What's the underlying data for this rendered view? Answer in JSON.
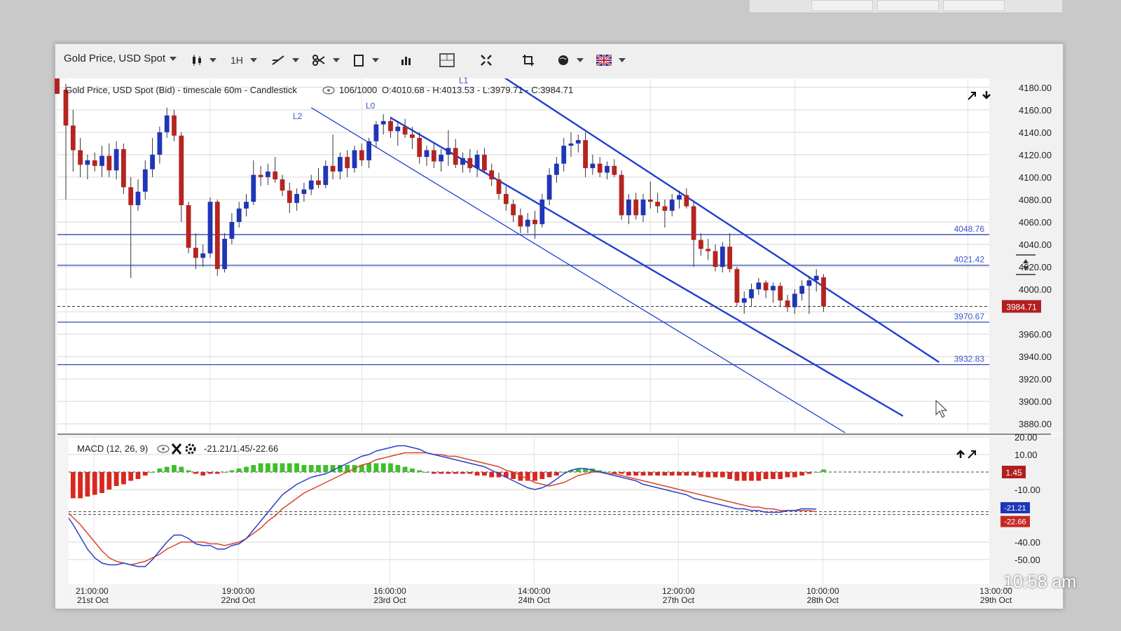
{
  "toolbar": {
    "instrument": "Gold Price, USD Spot",
    "timeframe": "1H"
  },
  "main_chart": {
    "header": "Gold Price, USD Spot (Bid) - timescale 60m - Candlestick",
    "counter": "106/1000",
    "ohlc": "O:4010.68 - H:4013.53 - L:3979.71 - C:3984.71",
    "channel_labels": [
      "L2",
      "L0",
      "L1"
    ],
    "last_price_label": "3984.71"
  },
  "macd": {
    "title": "MACD (12, 26, 9)",
    "values": "-21.21/1.45/-22.66",
    "hist_label": "1.45",
    "macd_label": "-21.21",
    "signal_label": "-22.66"
  },
  "chart_data": [
    {
      "type": "candlestick",
      "title": "Gold Price, USD Spot (Bid) - timescale 60m - Candlestick",
      "y_ticks": [
        4180,
        4160,
        4140,
        4120,
        4100,
        4080,
        4060,
        4040,
        4020,
        4000,
        3980,
        3960,
        3940,
        3920,
        3900,
        3880
      ],
      "y_tick_labels": [
        "4180.00",
        "4160.00",
        "4140.00",
        "4120.00",
        "4100.00",
        "4080.00",
        "4060.00",
        "4040.00",
        "4020.00",
        "4000.00",
        "",
        "3960.00",
        "3940.00",
        "3920.00",
        "3900.00",
        "3880.00"
      ],
      "ylim": [
        3872,
        4188
      ],
      "x_ticks": [
        {
          "idx": 0,
          "time": "21:00:00",
          "date": "21st Oct"
        },
        {
          "idx": 20,
          "time": "19:00:00",
          "date": "22nd Oct"
        },
        {
          "idx": 41,
          "time": "16:00:00",
          "date": "23rd Oct"
        },
        {
          "idx": 61,
          "time": "14:00:00",
          "date": "24th Oct"
        },
        {
          "idx": 81,
          "time": "12:00:00",
          "date": "27th Oct"
        },
        {
          "idx": 101,
          "time": "10:00:00",
          "date": "28th Oct"
        },
        {
          "idx": 125,
          "time": "13:00:00",
          "date": "29th Oct"
        }
      ],
      "horizontal_levels": [
        {
          "value": 4048.76,
          "label": "4048.76"
        },
        {
          "value": 4021.42,
          "label": "4021.42"
        },
        {
          "value": 3970.67,
          "label": "3970.67"
        },
        {
          "value": 3932.83,
          "label": "3932.83"
        }
      ],
      "last_price": 3984.71,
      "channel_lines": [
        {
          "name": "L1",
          "from": [
            60,
            4192
          ],
          "to": [
            121,
            3935
          ]
        },
        {
          "name": "L0",
          "from": [
            45,
            4153
          ],
          "to": [
            116,
            3887
          ]
        },
        {
          "name": "L2",
          "from": [
            34,
            4162
          ],
          "to": [
            108,
            3872
          ]
        }
      ],
      "candles": [
        {
          "o": 4178,
          "h": 4183,
          "l": 4080,
          "c": 4146
        },
        {
          "o": 4146,
          "h": 4160,
          "l": 4105,
          "c": 4124
        },
        {
          "o": 4124,
          "h": 4135,
          "l": 4100,
          "c": 4111
        },
        {
          "o": 4111,
          "h": 4120,
          "l": 4098,
          "c": 4115
        },
        {
          "o": 4115,
          "h": 4122,
          "l": 4105,
          "c": 4110
        },
        {
          "o": 4110,
          "h": 4128,
          "l": 4100,
          "c": 4119
        },
        {
          "o": 4119,
          "h": 4130,
          "l": 4100,
          "c": 4106
        },
        {
          "o": 4106,
          "h": 4132,
          "l": 4098,
          "c": 4125
        },
        {
          "o": 4125,
          "h": 4130,
          "l": 4085,
          "c": 4091
        },
        {
          "o": 4091,
          "h": 4100,
          "l": 4010,
          "c": 4075
        },
        {
          "o": 4075,
          "h": 4098,
          "l": 4070,
          "c": 4087
        },
        {
          "o": 4087,
          "h": 4115,
          "l": 4080,
          "c": 4107
        },
        {
          "o": 4107,
          "h": 4135,
          "l": 4100,
          "c": 4120
        },
        {
          "o": 4120,
          "h": 4145,
          "l": 4112,
          "c": 4140
        },
        {
          "o": 4140,
          "h": 4162,
          "l": 4135,
          "c": 4155
        },
        {
          "o": 4155,
          "h": 4160,
          "l": 4132,
          "c": 4137
        },
        {
          "o": 4137,
          "h": 4140,
          "l": 4060,
          "c": 4075
        },
        {
          "o": 4075,
          "h": 4078,
          "l": 4032,
          "c": 4037
        },
        {
          "o": 4037,
          "h": 4050,
          "l": 4018,
          "c": 4028
        },
        {
          "o": 4028,
          "h": 4040,
          "l": 4020,
          "c": 4032
        },
        {
          "o": 4032,
          "h": 4082,
          "l": 4028,
          "c": 4078
        },
        {
          "o": 4078,
          "h": 4080,
          "l": 4012,
          "c": 4018
        },
        {
          "o": 4018,
          "h": 4050,
          "l": 4015,
          "c": 4045
        },
        {
          "o": 4045,
          "h": 4068,
          "l": 4040,
          "c": 4060
        },
        {
          "o": 4060,
          "h": 4078,
          "l": 4055,
          "c": 4072
        },
        {
          "o": 4072,
          "h": 4085,
          "l": 4065,
          "c": 4078
        },
        {
          "o": 4078,
          "h": 4115,
          "l": 4075,
          "c": 4102
        },
        {
          "o": 4102,
          "h": 4110,
          "l": 4092,
          "c": 4100
        },
        {
          "o": 4100,
          "h": 4112,
          "l": 4093,
          "c": 4105
        },
        {
          "o": 4105,
          "h": 4118,
          "l": 4095,
          "c": 4098
        },
        {
          "o": 4098,
          "h": 4102,
          "l": 4083,
          "c": 4088
        },
        {
          "o": 4088,
          "h": 4095,
          "l": 4068,
          "c": 4077
        },
        {
          "o": 4077,
          "h": 4090,
          "l": 4070,
          "c": 4085
        },
        {
          "o": 4085,
          "h": 4095,
          "l": 4078,
          "c": 4089
        },
        {
          "o": 4089,
          "h": 4102,
          "l": 4084,
          "c": 4097
        },
        {
          "o": 4097,
          "h": 4108,
          "l": 4090,
          "c": 4093
        },
        {
          "o": 4093,
          "h": 4115,
          "l": 4090,
          "c": 4110
        },
        {
          "o": 4110,
          "h": 4138,
          "l": 4098,
          "c": 4105
        },
        {
          "o": 4105,
          "h": 4122,
          "l": 4098,
          "c": 4118
        },
        {
          "o": 4118,
          "h": 4124,
          "l": 4100,
          "c": 4108
        },
        {
          "o": 4108,
          "h": 4128,
          "l": 4104,
          "c": 4124
        },
        {
          "o": 4124,
          "h": 4130,
          "l": 4110,
          "c": 4115
        },
        {
          "o": 4115,
          "h": 4135,
          "l": 4108,
          "c": 4132
        },
        {
          "o": 4132,
          "h": 4150,
          "l": 4126,
          "c": 4147
        },
        {
          "o": 4147,
          "h": 4156,
          "l": 4138,
          "c": 4150
        },
        {
          "o": 4150,
          "h": 4154,
          "l": 4135,
          "c": 4141
        },
        {
          "o": 4141,
          "h": 4150,
          "l": 4128,
          "c": 4145
        },
        {
          "o": 4145,
          "h": 4152,
          "l": 4135,
          "c": 4138
        },
        {
          "o": 4138,
          "h": 4145,
          "l": 4125,
          "c": 4135
        },
        {
          "o": 4135,
          "h": 4140,
          "l": 4112,
          "c": 4118
        },
        {
          "o": 4118,
          "h": 4128,
          "l": 4110,
          "c": 4124
        },
        {
          "o": 4124,
          "h": 4130,
          "l": 4108,
          "c": 4114
        },
        {
          "o": 4114,
          "h": 4125,
          "l": 4105,
          "c": 4120
        },
        {
          "o": 4120,
          "h": 4142,
          "l": 4110,
          "c": 4126
        },
        {
          "o": 4126,
          "h": 4134,
          "l": 4108,
          "c": 4111
        },
        {
          "o": 4111,
          "h": 4122,
          "l": 4104,
          "c": 4117
        },
        {
          "o": 4117,
          "h": 4125,
          "l": 4104,
          "c": 4108
        },
        {
          "o": 4108,
          "h": 4124,
          "l": 4100,
          "c": 4120
        },
        {
          "o": 4120,
          "h": 4126,
          "l": 4104,
          "c": 4106
        },
        {
          "o": 4106,
          "h": 4112,
          "l": 4092,
          "c": 4098
        },
        {
          "o": 4098,
          "h": 4104,
          "l": 4080,
          "c": 4085
        },
        {
          "o": 4085,
          "h": 4092,
          "l": 4070,
          "c": 4076
        },
        {
          "o": 4076,
          "h": 4080,
          "l": 4060,
          "c": 4066
        },
        {
          "o": 4066,
          "h": 4072,
          "l": 4050,
          "c": 4056
        },
        {
          "o": 4056,
          "h": 4068,
          "l": 4050,
          "c": 4062
        },
        {
          "o": 4062,
          "h": 4070,
          "l": 4045,
          "c": 4058
        },
        {
          "o": 4058,
          "h": 4085,
          "l": 4055,
          "c": 4080
        },
        {
          "o": 4080,
          "h": 4108,
          "l": 4075,
          "c": 4102
        },
        {
          "o": 4102,
          "h": 4118,
          "l": 4095,
          "c": 4112
        },
        {
          "o": 4112,
          "h": 4135,
          "l": 4105,
          "c": 4128
        },
        {
          "o": 4128,
          "h": 4140,
          "l": 4118,
          "c": 4130
        },
        {
          "o": 4130,
          "h": 4138,
          "l": 4122,
          "c": 4133
        },
        {
          "o": 4133,
          "h": 4140,
          "l": 4100,
          "c": 4108
        },
        {
          "o": 4108,
          "h": 4120,
          "l": 4102,
          "c": 4112
        },
        {
          "o": 4112,
          "h": 4118,
          "l": 4100,
          "c": 4104
        },
        {
          "o": 4104,
          "h": 4114,
          "l": 4098,
          "c": 4110
        },
        {
          "o": 4110,
          "h": 4116,
          "l": 4100,
          "c": 4102
        },
        {
          "o": 4102,
          "h": 4106,
          "l": 4062,
          "c": 4066
        },
        {
          "o": 4066,
          "h": 4085,
          "l": 4058,
          "c": 4080
        },
        {
          "o": 4080,
          "h": 4086,
          "l": 4062,
          "c": 4066
        },
        {
          "o": 4066,
          "h": 4085,
          "l": 4060,
          "c": 4080
        },
        {
          "o": 4080,
          "h": 4096,
          "l": 4072,
          "c": 4078
        },
        {
          "o": 4078,
          "h": 4086,
          "l": 4068,
          "c": 4074
        },
        {
          "o": 4074,
          "h": 4080,
          "l": 4055,
          "c": 4070
        },
        {
          "o": 4070,
          "h": 4085,
          "l": 4065,
          "c": 4080
        },
        {
          "o": 4080,
          "h": 4088,
          "l": 4072,
          "c": 4084
        },
        {
          "o": 4084,
          "h": 4090,
          "l": 4072,
          "c": 4074
        },
        {
          "o": 4074,
          "h": 4078,
          "l": 4020,
          "c": 4044
        },
        {
          "o": 4044,
          "h": 4050,
          "l": 4030,
          "c": 4036
        },
        {
          "o": 4036,
          "h": 4045,
          "l": 4026,
          "c": 4034
        },
        {
          "o": 4034,
          "h": 4040,
          "l": 4016,
          "c": 4020
        },
        {
          "o": 4020,
          "h": 4042,
          "l": 4015,
          "c": 4038
        },
        {
          "o": 4038,
          "h": 4050,
          "l": 4015,
          "c": 4018
        },
        {
          "o": 4018,
          "h": 4020,
          "l": 3985,
          "c": 3988
        },
        {
          "o": 3988,
          "h": 3998,
          "l": 3978,
          "c": 3992
        },
        {
          "o": 3992,
          "h": 4005,
          "l": 3985,
          "c": 4000
        },
        {
          "o": 4000,
          "h": 4010,
          "l": 3995,
          "c": 4006
        },
        {
          "o": 4006,
          "h": 4008,
          "l": 3992,
          "c": 3999
        },
        {
          "o": 3999,
          "h": 4006,
          "l": 3988,
          "c": 4003
        },
        {
          "o": 4003,
          "h": 4006,
          "l": 3985,
          "c": 3990
        },
        {
          "o": 3990,
          "h": 3995,
          "l": 3980,
          "c": 3984
        },
        {
          "o": 3984,
          "h": 4000,
          "l": 3978,
          "c": 3996
        },
        {
          "o": 3996,
          "h": 4008,
          "l": 3990,
          "c": 4003
        },
        {
          "o": 4003,
          "h": 4012,
          "l": 3978,
          "c": 4008
        },
        {
          "o": 4008,
          "h": 4018,
          "l": 3998,
          "c": 4012
        },
        {
          "o": 4010.68,
          "h": 4013.53,
          "l": 3979.71,
          "c": 3984.71
        }
      ]
    },
    {
      "type": "macd",
      "title": "MACD (12, 26, 9)",
      "y_ticks": [
        20,
        10,
        -10,
        -40,
        -50
      ],
      "y_tick_labels": [
        "20.00",
        "10.00",
        "-10.00",
        "-40.00",
        "-50.00"
      ],
      "ylim": [
        -64,
        20
      ],
      "x_ticks_same_as_price": true,
      "reference_level": -22.66,
      "histogram": [
        -16,
        -15,
        -15,
        -14,
        -13,
        -12,
        -10,
        -8,
        -7,
        -5,
        -4,
        -2,
        0,
        2,
        3,
        4,
        3,
        1,
        -1,
        -2,
        -1,
        -1,
        0,
        1,
        2,
        3,
        4,
        5,
        5,
        5,
        5,
        5,
        5,
        4,
        4,
        4,
        4,
        4,
        4,
        4,
        4,
        4,
        5,
        5,
        5,
        5,
        4,
        3,
        2,
        1,
        0,
        -1,
        -1,
        -1,
        -1,
        -1,
        -1,
        -2,
        -2,
        -3,
        -3,
        -3,
        -4,
        -5,
        -5,
        -5,
        -4,
        -3,
        -2,
        0,
        1,
        2,
        2,
        2,
        1,
        0,
        -1,
        -1,
        -2,
        -2,
        -2,
        -2,
        -2,
        -2,
        -2,
        -2,
        -2,
        -2,
        -3,
        -3,
        -3,
        -3,
        -4,
        -5,
        -5,
        -5,
        -5,
        -4,
        -4,
        -4,
        -3,
        -3,
        -2,
        -1,
        0,
        1.45
      ],
      "macd_line": [
        -24,
        -30,
        -37,
        -44,
        -49,
        -52,
        -53,
        -53,
        -52,
        -53,
        -54,
        -54,
        -50,
        -45,
        -40,
        -36,
        -36,
        -38,
        -41,
        -42,
        -42,
        -44,
        -44,
        -42,
        -41,
        -38,
        -33,
        -28,
        -23,
        -18,
        -13,
        -10,
        -7,
        -5,
        -3,
        -2,
        -1,
        1,
        3,
        5,
        7,
        9,
        10,
        12,
        13,
        14,
        15,
        15,
        14,
        13,
        11,
        10,
        9,
        8,
        7,
        6,
        5,
        4,
        3,
        1,
        -1,
        -3,
        -5,
        -7,
        -9,
        -10,
        -9,
        -7,
        -4,
        -1,
        1,
        2,
        2,
        1,
        0,
        -1,
        -2,
        -3,
        -4,
        -5,
        -7,
        -8,
        -9,
        -10,
        -11,
        -12,
        -13,
        -15,
        -16,
        -17,
        -18,
        -19,
        -20,
        -21,
        -21,
        -22,
        -22,
        -23,
        -23,
        -23,
        -22,
        -22,
        -21,
        -21,
        -21.21
      ],
      "signal_line": [
        -22,
        -26,
        -30,
        -35,
        -40,
        -45,
        -49,
        -51,
        -52,
        -53,
        -52,
        -51,
        -49,
        -47,
        -44,
        -42,
        -40,
        -40,
        -40,
        -40,
        -41,
        -41,
        -42,
        -41,
        -40,
        -38,
        -35,
        -32,
        -28,
        -25,
        -21,
        -18,
        -15,
        -12,
        -10,
        -8,
        -6,
        -4,
        -2,
        0,
        2,
        4,
        5,
        7,
        8,
        9,
        10,
        11,
        11,
        11,
        11,
        10,
        10,
        9,
        9,
        8,
        7,
        6,
        5,
        4,
        3,
        1,
        0,
        -2,
        -4,
        -6,
        -7,
        -8,
        -7,
        -6,
        -4,
        -2,
        -1,
        0,
        0,
        -1,
        -1,
        -2,
        -3,
        -4,
        -5,
        -6,
        -7,
        -8,
        -9,
        -10,
        -11,
        -12,
        -13,
        -14,
        -15,
        -16,
        -17,
        -18,
        -19,
        -20,
        -20,
        -21,
        -21,
        -22,
        -22,
        -22,
        -22,
        -22,
        -22.66
      ]
    }
  ],
  "clock": "10:58 am"
}
